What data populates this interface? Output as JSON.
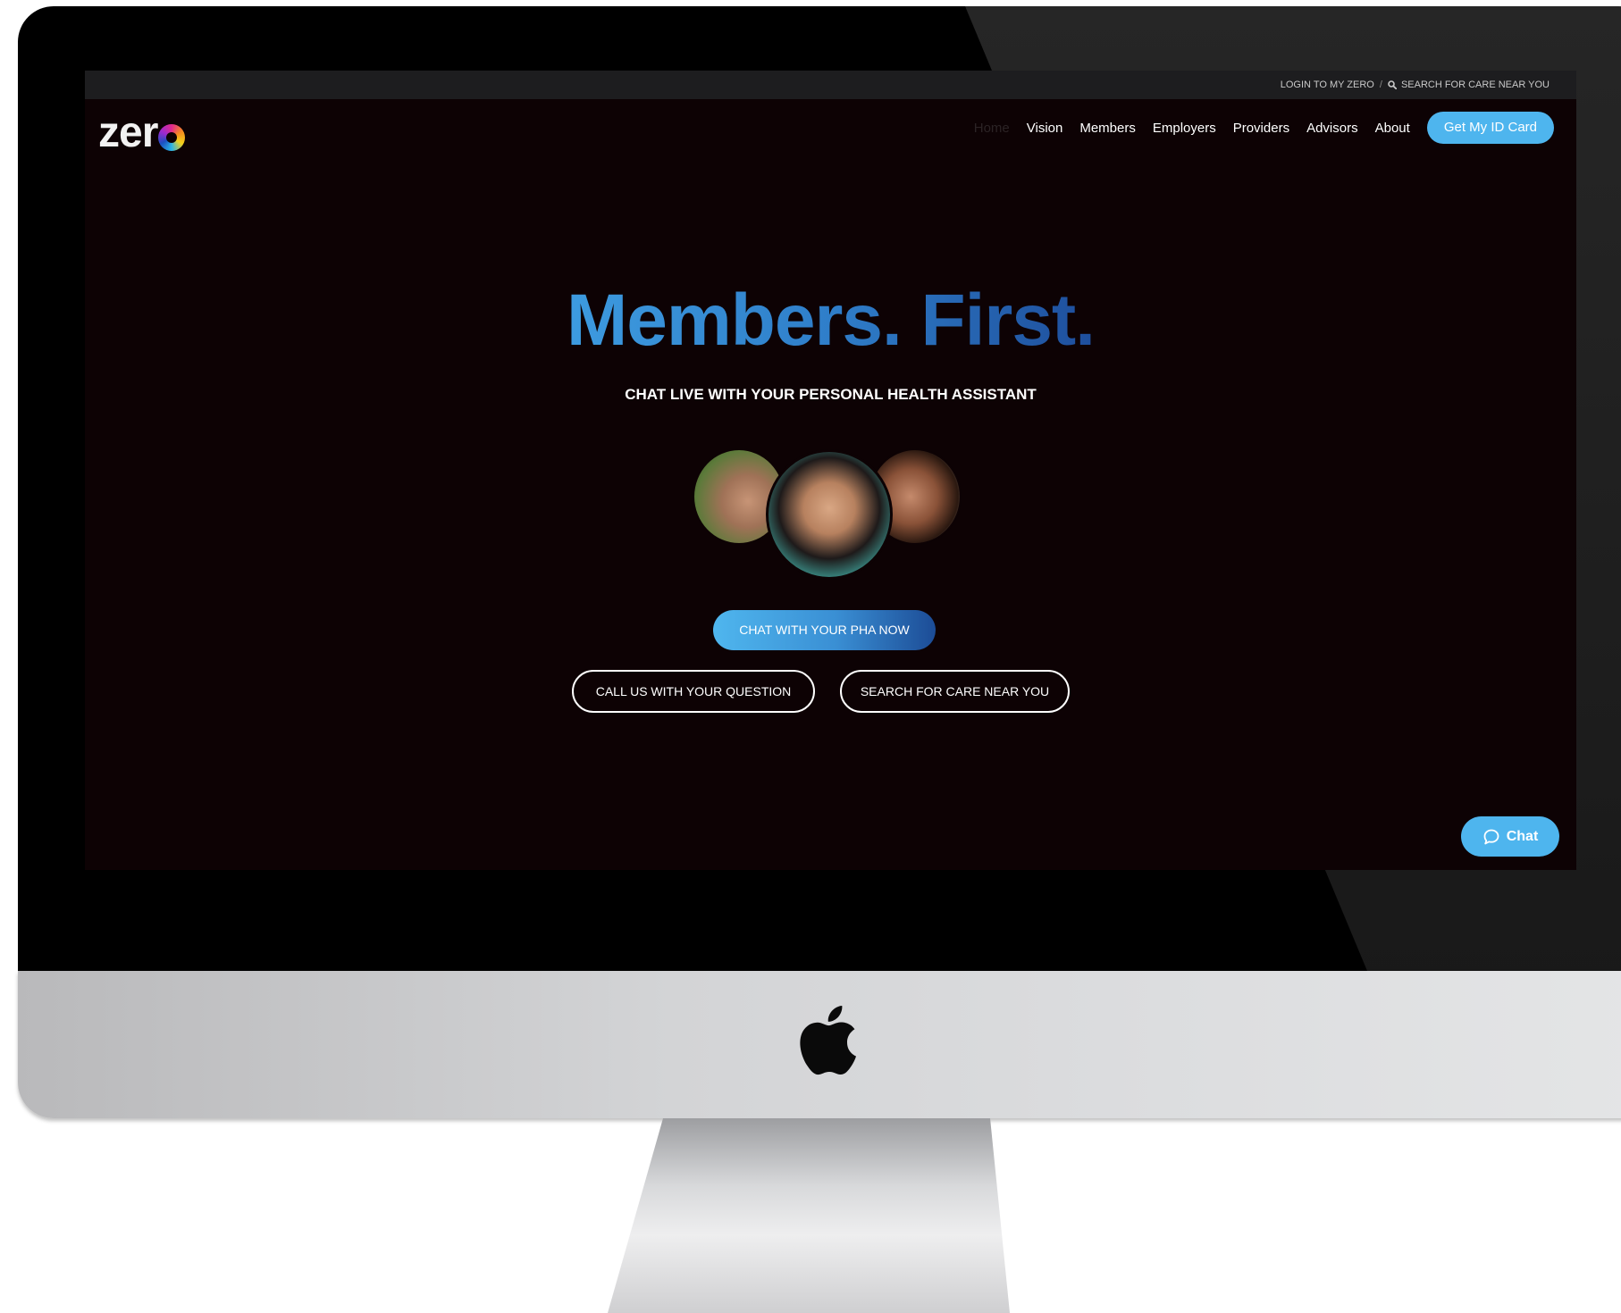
{
  "topbar": {
    "login_label": "LOGIN TO MY ZERO",
    "separator": "/",
    "search_label": "SEARCH FOR CARE NEAR YOU",
    "search_icon": "search-icon"
  },
  "brand": {
    "logo_text": "zer"
  },
  "nav": {
    "items": [
      {
        "label": "Home",
        "active": true
      },
      {
        "label": "Vision"
      },
      {
        "label": "Members"
      },
      {
        "label": "Employers"
      },
      {
        "label": "Providers"
      },
      {
        "label": "Advisors"
      },
      {
        "label": "About"
      }
    ],
    "cta_label": "Get My ID Card"
  },
  "hero": {
    "title": "Members. First.",
    "subtitle": "CHAT LIVE WITH YOUR PERSONAL HEALTH ASSISTANT",
    "primary_button": "CHAT WITH YOUR PHA NOW",
    "call_button": "CALL US WITH YOUR QUESTION",
    "search_button": "SEARCH FOR CARE NEAR YOU"
  },
  "chat_widget": {
    "label": "Chat",
    "icon": "chat-bubble-icon"
  },
  "colors": {
    "accent": "#4eb5ee",
    "page_background": "#0d0204",
    "title_gradient_start": "#3d9be0",
    "title_gradient_end": "#1e4e9c"
  }
}
